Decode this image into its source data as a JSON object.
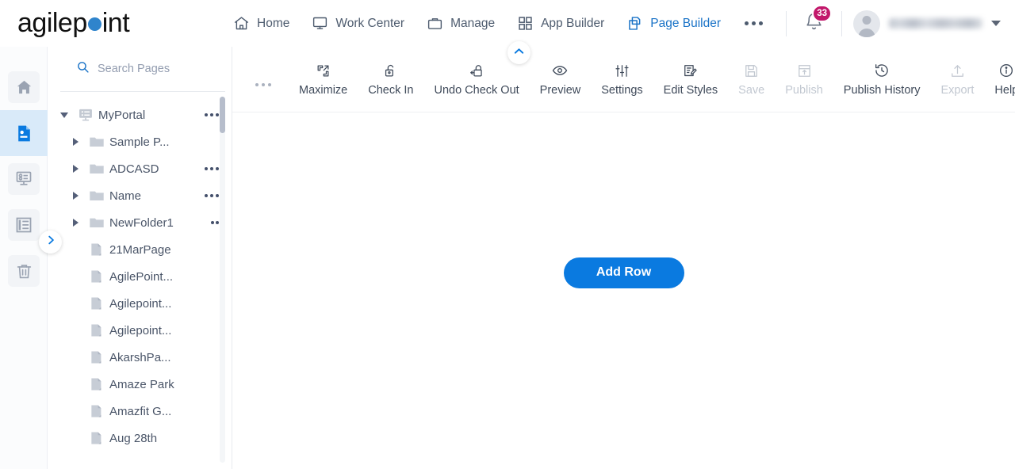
{
  "brand": {
    "name_part1": "agilep",
    "name_part2": "int",
    "dot": "o-as-dot",
    "accent": "#2f84cc"
  },
  "topnav": {
    "items": [
      {
        "label": "Home",
        "icon": "home-icon",
        "active": false
      },
      {
        "label": "Work Center",
        "icon": "monitor-icon",
        "active": false
      },
      {
        "label": "Manage",
        "icon": "briefcase-icon",
        "active": false
      },
      {
        "label": "App Builder",
        "icon": "grid-squares-icon",
        "active": false
      },
      {
        "label": "Page Builder",
        "icon": "copy-pages-icon",
        "active": true
      }
    ],
    "overflow_icon": "ellipsis-icon",
    "notifications": {
      "icon": "bell-icon",
      "count": "33",
      "badge_color": "#c2186b"
    },
    "user": {
      "name": "",
      "avatar_icon": "user-avatar-icon",
      "caret_icon": "chevron-down-icon"
    }
  },
  "rail": {
    "items": [
      {
        "icon": "home-icon",
        "name": "rail-home",
        "active": false
      },
      {
        "icon": "page-document-icon",
        "name": "rail-pages",
        "active": true
      },
      {
        "icon": "form-layout-icon",
        "name": "rail-forms",
        "active": false
      },
      {
        "icon": "list-layout-icon",
        "name": "rail-layouts",
        "active": false
      },
      {
        "icon": "trash-icon",
        "name": "rail-recycle-bin",
        "active": false
      }
    ],
    "expand_icon": "chevron-right-icon"
  },
  "tree": {
    "search": {
      "placeholder": "Search Pages",
      "value": "",
      "icon": "search-icon"
    },
    "nodes": [
      {
        "label": "MyPortal",
        "type": "portal",
        "level": 0,
        "expanded": true,
        "menu": true
      },
      {
        "label": "Sample P...",
        "type": "folder",
        "level": 1,
        "expanded": false,
        "menu": false
      },
      {
        "label": "ADCASD",
        "type": "folder",
        "level": 1,
        "expanded": false,
        "menu": true
      },
      {
        "label": "Name",
        "type": "folder",
        "level": 1,
        "expanded": false,
        "menu": true
      },
      {
        "label": "NewFolder1",
        "type": "folder",
        "level": 1,
        "expanded": false,
        "menu": true
      },
      {
        "label": "21MarPage",
        "type": "page",
        "level": 1,
        "expanded": null,
        "menu": false
      },
      {
        "label": "AgilePoint...",
        "type": "page",
        "level": 1,
        "expanded": null,
        "menu": false
      },
      {
        "label": "Agilepoint...",
        "type": "page",
        "level": 1,
        "expanded": null,
        "menu": false
      },
      {
        "label": "Agilepoint...",
        "type": "page",
        "level": 1,
        "expanded": null,
        "menu": false
      },
      {
        "label": "AkarshPa...",
        "type": "page",
        "level": 1,
        "expanded": null,
        "menu": false
      },
      {
        "label": "Amaze Park",
        "type": "page",
        "level": 1,
        "expanded": null,
        "menu": false
      },
      {
        "label": "Amazfit G...",
        "type": "page",
        "level": 1,
        "expanded": null,
        "menu": false
      },
      {
        "label": "Aug 28th",
        "type": "page",
        "level": 1,
        "expanded": null,
        "menu": false
      }
    ]
  },
  "toolbar": {
    "overflow_left_icon": "ellipsis-icon",
    "items": [
      {
        "label": "Maximize",
        "icon": "maximize-icon",
        "disabled": false
      },
      {
        "label": "Check In",
        "icon": "unlock-icon",
        "disabled": false
      },
      {
        "label": "Undo Check Out",
        "icon": "lock-undo-icon",
        "disabled": false
      },
      {
        "label": "Preview",
        "icon": "eye-icon",
        "disabled": false
      },
      {
        "label": "Settings",
        "icon": "sliders-icon",
        "disabled": false
      },
      {
        "label": "Edit Styles",
        "icon": "edit-styles-icon",
        "disabled": false
      },
      {
        "label": "Save",
        "icon": "save-disk-icon",
        "disabled": true
      },
      {
        "label": "Publish",
        "icon": "publish-icon",
        "disabled": true
      },
      {
        "label": "Publish History",
        "icon": "history-clock-icon",
        "disabled": false
      },
      {
        "label": "Export",
        "icon": "upload-export-icon",
        "disabled": true
      },
      {
        "label": "Help",
        "icon": "info-circle-icon",
        "disabled": false
      }
    ],
    "more_icon": "ellipsis-icon",
    "more_caret_icon": "chevron-down-icon",
    "collapse_icon": "chevron-up-icon"
  },
  "canvas": {
    "add_row_label": "Add Row",
    "accent": "#0a7ae0"
  }
}
